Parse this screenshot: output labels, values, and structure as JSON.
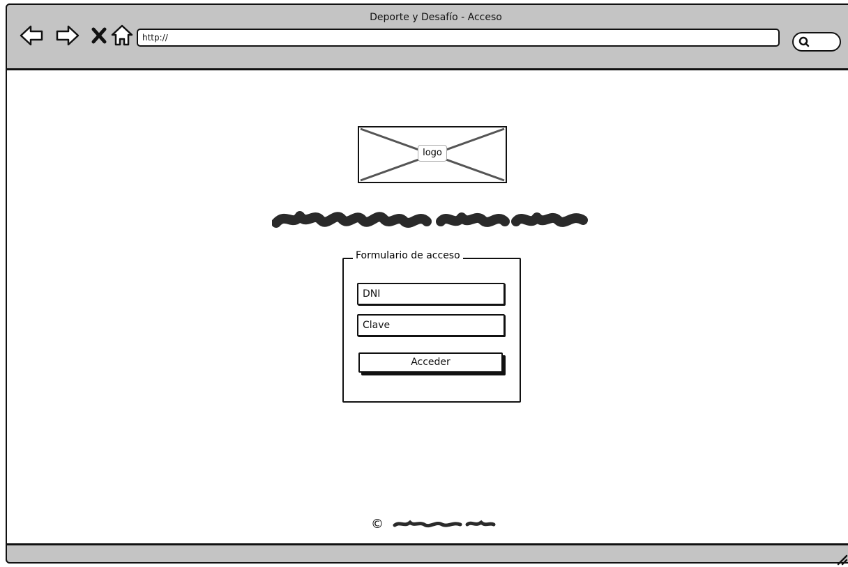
{
  "window": {
    "title": "Deporte y Desafío - Acceso"
  },
  "toolbar": {
    "url": "http://"
  },
  "icons": {
    "back": "back-arrow-icon",
    "forward": "forward-arrow-icon",
    "stop": "close-icon",
    "home": "home-icon",
    "search": "search-icon",
    "resize": "resize-grip-icon"
  },
  "page": {
    "logo_label": "logo",
    "form": {
      "legend": "Formulario de acceso",
      "dni_placeholder": "DNI",
      "password_placeholder": "Clave",
      "submit_label": "Acceder"
    },
    "footer": {
      "copyright_symbol": "©"
    }
  }
}
